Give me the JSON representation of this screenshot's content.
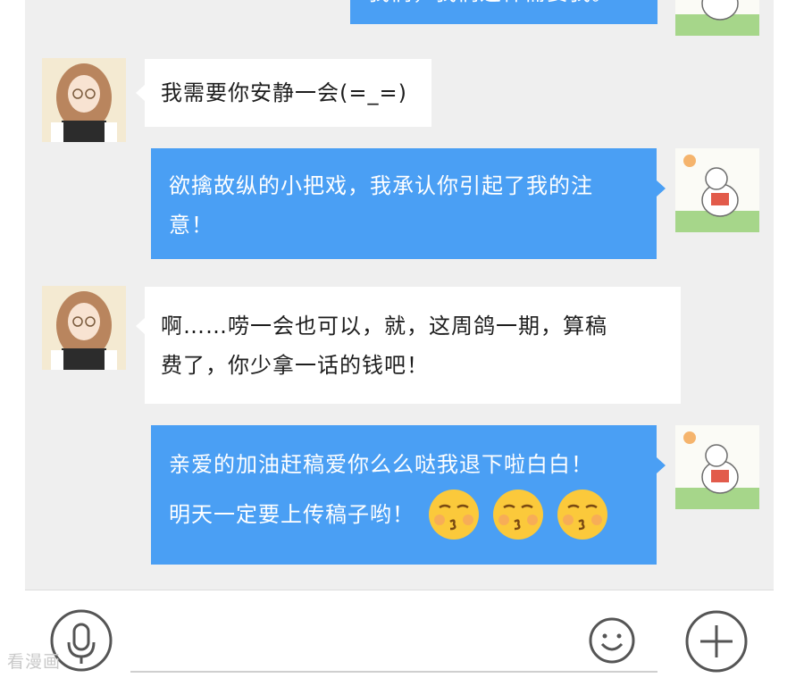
{
  "messages": [
    {
      "side": "out",
      "text": "我们，我们这样需要我。"
    },
    {
      "side": "in",
      "sender": "author",
      "text": "我需要你安静一会(=_=)"
    },
    {
      "side": "out",
      "sender": "editor",
      "lines": [
        "欲擒故纵的小把戏，我承认你引起了我的注",
        "意！"
      ]
    },
    {
      "side": "in",
      "sender": "author",
      "lines": [
        "啊……唠一会也可以，就，这周鸽一期，算稿",
        "费了，你少拿一话的钱吧！"
      ]
    },
    {
      "side": "out",
      "sender": "editor",
      "lines": [
        "亲爱的加油赶稿爱你么么哒我退下啦白白！",
        "明天一定要上传稿子哟！"
      ],
      "emoji": [
        "kissing-face",
        "kissing-face",
        "kissing-face"
      ]
    }
  ],
  "input_bar": {
    "voice_icon": "microphone-icon",
    "emoji_icon": "smiley-icon",
    "more_icon": "plus-icon"
  },
  "watermark": "看漫画",
  "colors": {
    "outgoing_bubble": "#4a9ff4",
    "incoming_bubble": "#ffffff",
    "chat_background": "#efefef"
  }
}
